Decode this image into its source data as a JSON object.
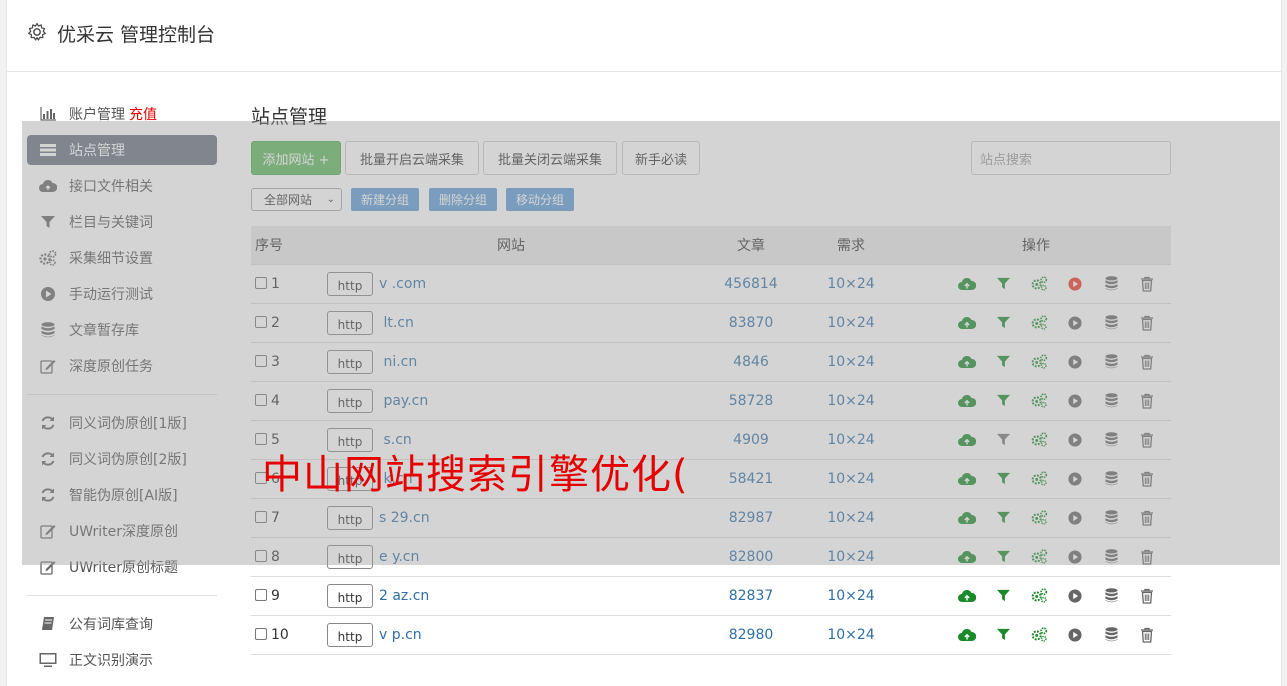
{
  "header": {
    "title": "优采云 管理控制台",
    "icon": "gear-icon"
  },
  "sidebar": {
    "items": [
      {
        "label": "账户管理",
        "extra": "充值",
        "icon": "bar-chart-icon"
      },
      {
        "label": "站点管理",
        "icon": "list-icon",
        "active": true
      },
      {
        "label": "接口文件相关",
        "icon": "cloud-icon"
      },
      {
        "label": "栏目与关键词",
        "icon": "filter-icon"
      },
      {
        "label": "采集细节设置",
        "icon": "cogs-icon"
      },
      {
        "label": "手动运行测试",
        "icon": "play-icon"
      },
      {
        "label": "文章暂存库",
        "icon": "database-icon"
      },
      {
        "label": "深度原创任务",
        "icon": "edit-icon"
      }
    ],
    "items2": [
      {
        "label": "同义词伪原创[1版]",
        "icon": "refresh-icon"
      },
      {
        "label": "同义词伪原创[2版]",
        "icon": "refresh-icon"
      },
      {
        "label": "智能伪原创[AI版]",
        "icon": "refresh-icon"
      },
      {
        "label": "UWriter深度原创",
        "icon": "edit-icon"
      },
      {
        "label": "UWriter原创标题",
        "icon": "edit-icon"
      }
    ],
    "items3": [
      {
        "label": "公有词库查询",
        "icon": "book-icon"
      },
      {
        "label": "正文识别演示",
        "icon": "monitor-icon"
      }
    ]
  },
  "main": {
    "title": "站点管理",
    "toolbar": {
      "add": "添加网站 +",
      "batch_open": "批量开启云端采集",
      "batch_close": "批量关闭云端采集",
      "newbie": "新手必读",
      "search_placeholder": "站点搜索"
    },
    "group": {
      "select_value": "全部网站",
      "new_group": "新建分组",
      "delete_group": "删除分组",
      "move_group": "移动分组"
    },
    "table": {
      "headers": [
        "序号",
        "网站",
        "文章",
        "需求",
        "操作"
      ],
      "rows": [
        {
          "no": "1",
          "prefix": "http",
          "site": "v         .com",
          "articles": "456814",
          "need": "10×24",
          "play_red": true
        },
        {
          "no": "2",
          "prefix": "http",
          "site": "      lt.cn",
          "articles": "83870",
          "need": "10×24"
        },
        {
          "no": "3",
          "prefix": "http",
          "site": "     ni.cn",
          "articles": "4846",
          "need": "10×24"
        },
        {
          "no": "4",
          "prefix": "http",
          "site": "      pay.cn",
          "articles": "58728",
          "need": "10×24"
        },
        {
          "no": "5",
          "prefix": "http",
          "site": "      s.cn",
          "articles": "4909",
          "need": "10×24",
          "filter_gray": true
        },
        {
          "no": "6",
          "prefix": "http",
          "site": "     k.cn",
          "articles": "58421",
          "need": "10×24"
        },
        {
          "no": "7",
          "prefix": "http",
          "site": "s  29.cn",
          "articles": "82987",
          "need": "10×24"
        },
        {
          "no": "8",
          "prefix": "http",
          "site": "e     y.cn",
          "articles": "82800",
          "need": "10×24"
        },
        {
          "no": "9",
          "prefix": "http",
          "site": "2   az.cn",
          "articles": "82837",
          "need": "10×24"
        },
        {
          "no": "10",
          "prefix": "http",
          "site": "v   p.cn",
          "articles": "82980",
          "need": "10×24"
        }
      ]
    }
  },
  "watermark": "中山网站搜索引擎优化(",
  "colors": {
    "green_btn": "#5cb85c",
    "blue_btn": "#5b9bd5",
    "active_side": "#666f80",
    "link": "#2f6fa7",
    "watermark": "#e60000"
  }
}
